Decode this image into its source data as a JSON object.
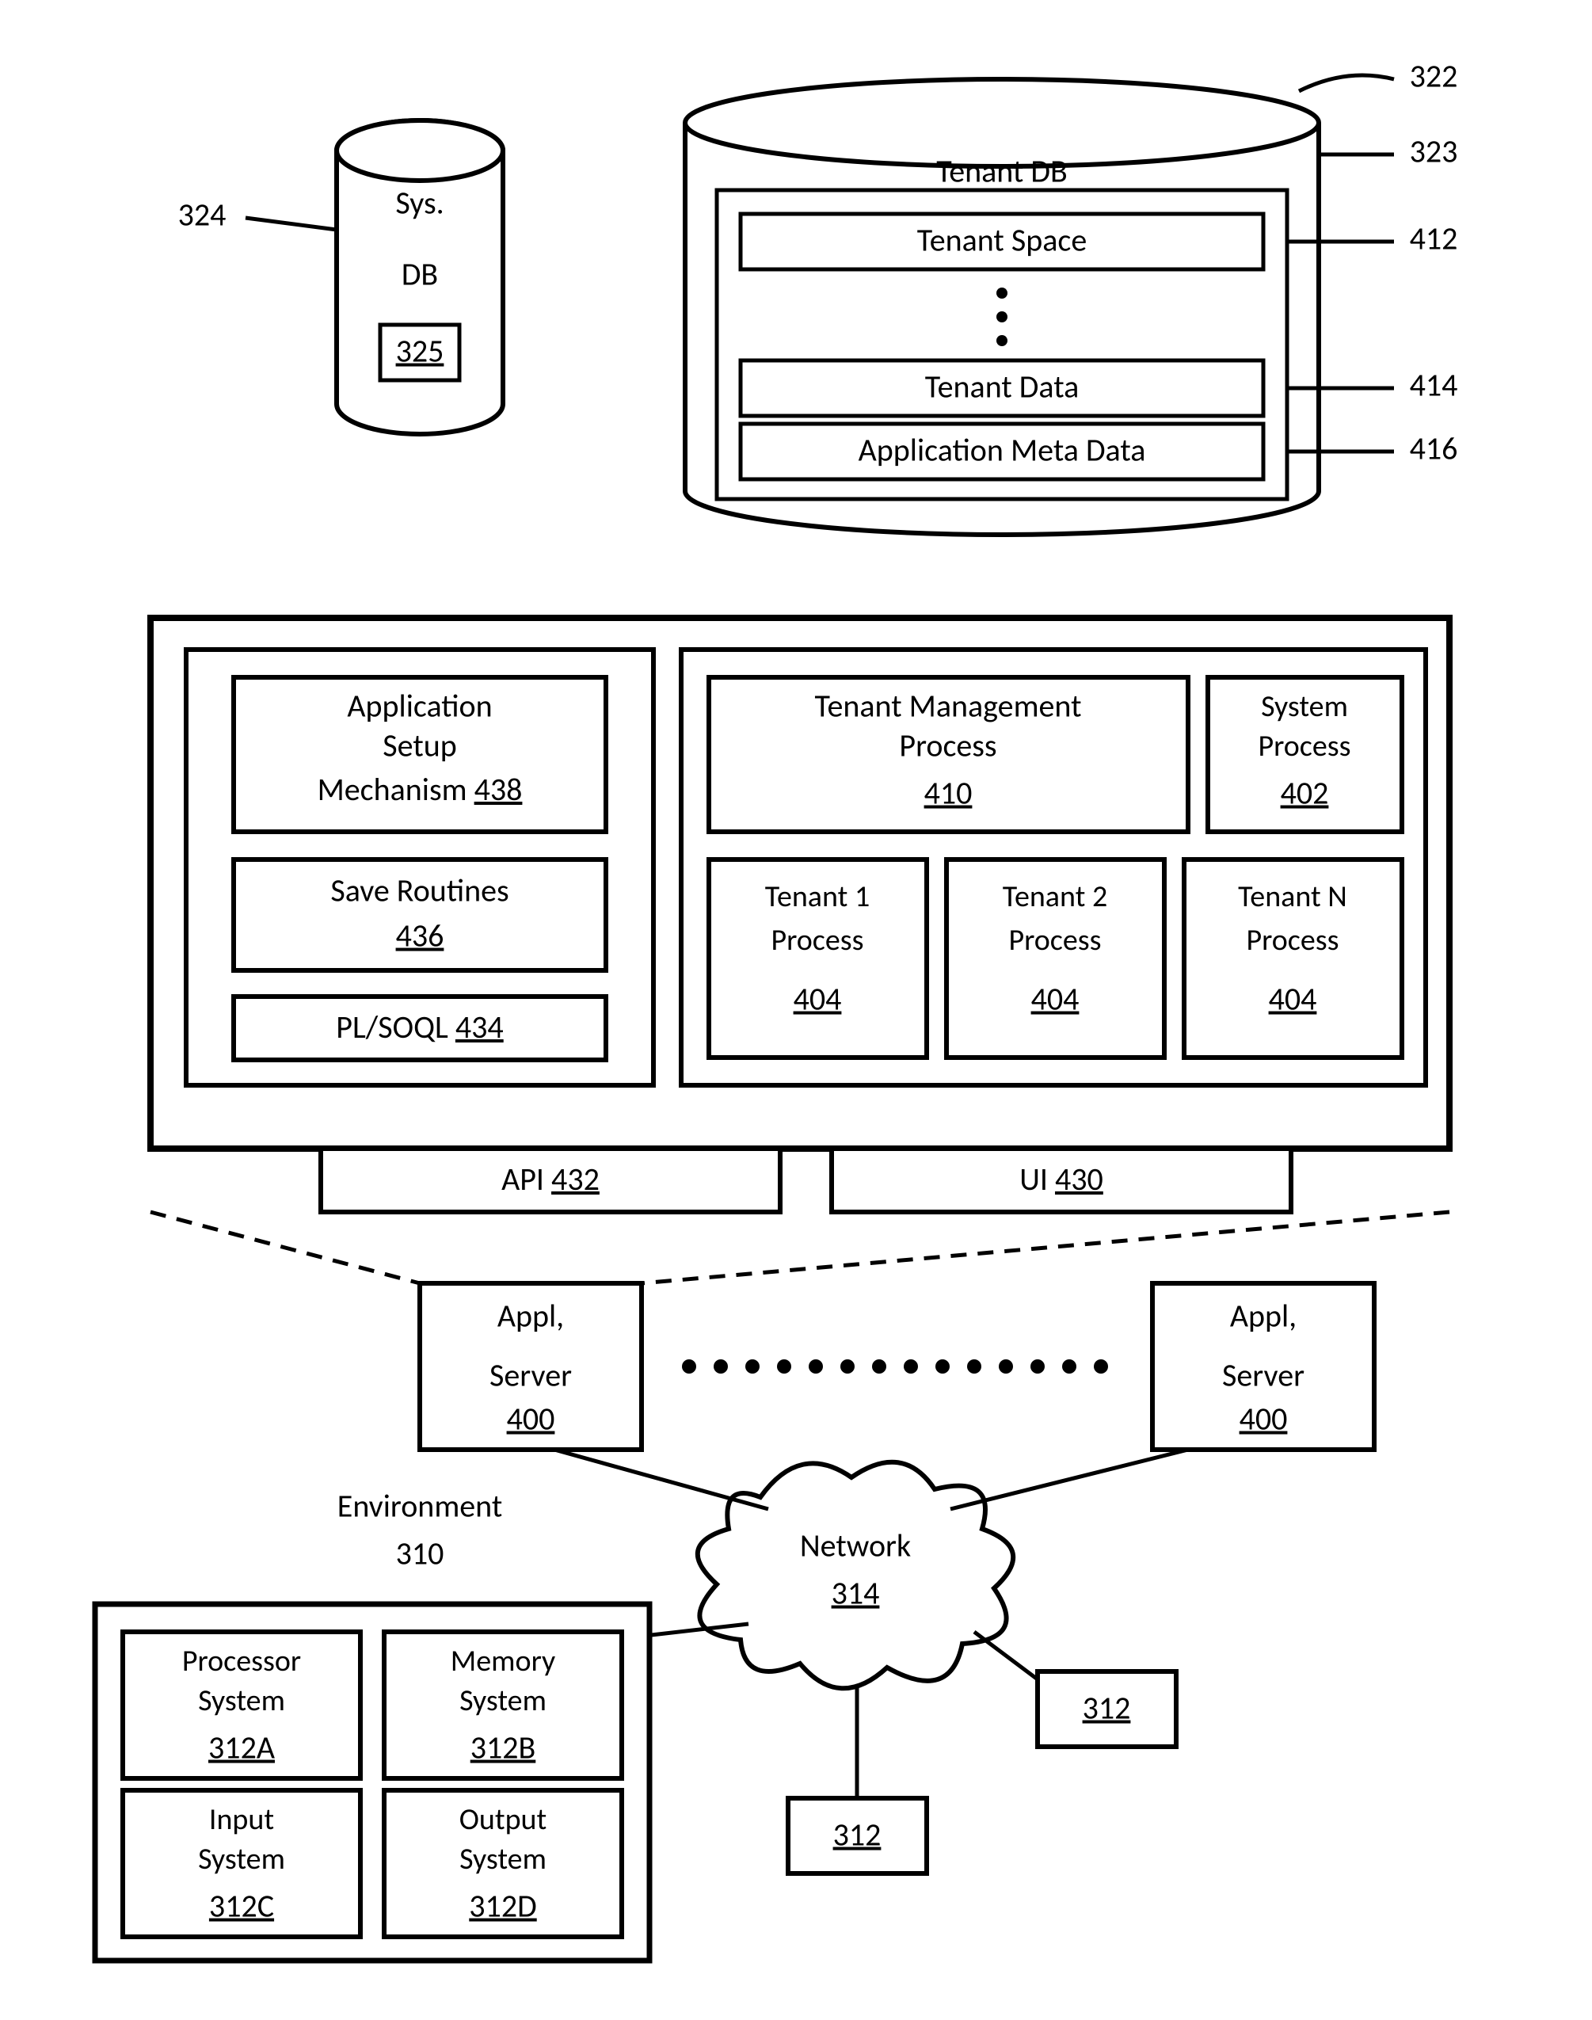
{
  "refs": {
    "sysdb_callout": "324",
    "tenant_outer_callout": "322",
    "tenant_inner_callout": "323",
    "tenant_space_callout": "412",
    "tenant_data_callout": "414",
    "app_meta_callout": "416"
  },
  "sysdb": {
    "line1": "Sys.",
    "line2": "DB",
    "ref": "325"
  },
  "tenantdb": {
    "title": "Tenant DB",
    "space": "Tenant Space",
    "data": "Tenant Data",
    "meta": "Application Meta Data"
  },
  "appserver": {
    "left_box": {
      "setup1": "Application",
      "setup2": "Setup",
      "setup3": "Mechanism ",
      "setup_ref": "438",
      "save": "Save Routines",
      "save_ref": "436",
      "plsoql": "PL/SOQL ",
      "plsoql_ref": "434"
    },
    "right_box": {
      "tmp1": "Tenant Management",
      "tmp2": "Process",
      "tmp_ref": "410",
      "sp1": "System",
      "sp2": "Process",
      "sp_ref": "402",
      "t1a": "Tenant 1",
      "t1b": "Process",
      "t1_ref": "404",
      "t2a": "Tenant 2",
      "t2b": "Process",
      "t2_ref": "404",
      "tna": "Tenant N",
      "tnb": "Process",
      "tn_ref": "404"
    },
    "api": "API ",
    "api_ref": "432",
    "ui": "UI ",
    "ui_ref": "430"
  },
  "servers": {
    "label1": "Appl,",
    "label2": "Server",
    "ref": "400"
  },
  "env": {
    "label": "Environment",
    "ref": "310"
  },
  "network": {
    "label": "Network",
    "ref": "314"
  },
  "clients": {
    "ref": "312"
  },
  "client_detail": {
    "p1": "Processor",
    "p2": "System",
    "p_ref": "312A",
    "m1": "Memory",
    "m2": "System",
    "m_ref": "312B",
    "i1": "Input",
    "i2": "System",
    "i_ref": "312C",
    "o1": "Output",
    "o2": "System",
    "o_ref": "312D"
  }
}
